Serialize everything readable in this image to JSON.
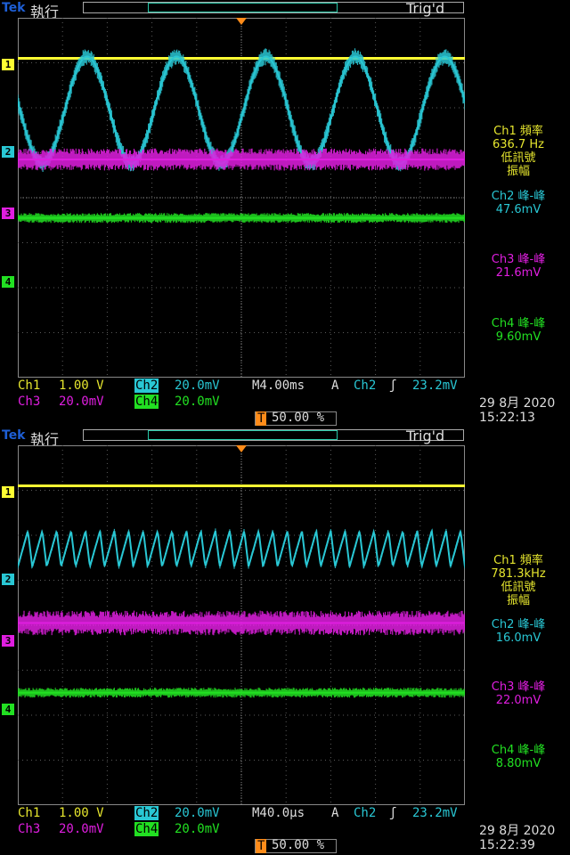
{
  "colors": {
    "ch1": "#ffff33",
    "ch2": "#29c7d4",
    "ch3": "#e01ee0",
    "ch4": "#22e022",
    "trigger": "#ff8c1a",
    "grid": "#5a5a5a",
    "background": "#000000"
  },
  "screens": [
    {
      "brand": "Tek",
      "run_state": "執行",
      "trig_state": "Trig'd",
      "measurements": [
        {
          "lines": [
            "Ch1 頻率",
            "636.7 Hz",
            "低訊號",
            "振幅"
          ]
        },
        {
          "lines": [
            "Ch2 峰-峰",
            "47.6mV"
          ]
        },
        {
          "lines": [
            "Ch3 峰-峰",
            "21.6mV"
          ]
        },
        {
          "lines": [
            "Ch4 峰-峰",
            "9.60mV"
          ]
        }
      ],
      "ch1_label": "Ch1",
      "ch1_scale": "1.00 V",
      "ch2_label": "Ch2",
      "ch2_scale": "20.0mV",
      "ch3_label": "Ch3",
      "ch3_scale": "20.0mV",
      "ch4_label": "Ch4",
      "ch4_scale": "20.0mV",
      "timebase": "M4.00ms",
      "trig_label": "A",
      "trig_ch": "Ch2",
      "trig_level": "23.2mV",
      "trig_pos": "50.00 %",
      "date": "29 8月  2020",
      "time": "15:22:13"
    },
    {
      "brand": "Tek",
      "run_state": "執行",
      "trig_state": "Trig'd",
      "measurements": [
        {
          "lines": [
            "Ch1 頻率",
            "781.3kHz",
            "低訊號",
            "振幅"
          ]
        },
        {
          "lines": [
            "Ch2 峰-峰",
            "16.0mV"
          ]
        },
        {
          "lines": [
            "Ch3 峰-峰",
            "22.0mV"
          ]
        },
        {
          "lines": [
            "Ch4 峰-峰",
            "8.80mV"
          ]
        }
      ],
      "ch1_label": "Ch1",
      "ch1_scale": "1.00 V",
      "ch2_label": "Ch2",
      "ch2_scale": "20.0mV",
      "ch3_label": "Ch3",
      "ch3_scale": "20.0mV",
      "ch4_label": "Ch4",
      "ch4_scale": "20.0mV",
      "timebase": "M40.0µs",
      "trig_label": "A",
      "trig_ch": "Ch2",
      "trig_level": "23.2mV",
      "trig_pos": "50.00 %",
      "date": "29 8月  2020",
      "time": "15:22:39"
    }
  ],
  "chart_data": [
    {
      "type": "line",
      "x_divisions": 10,
      "y_divisions": 8,
      "series": [
        {
          "name": "Ch1",
          "waveform": "flat",
          "level_div": 3.1
        },
        {
          "name": "Ch2",
          "waveform": "sine",
          "cycles": 5,
          "center_div": 1.95,
          "pp_div": 2.38,
          "noise_div": 0.35
        },
        {
          "name": "Ch3",
          "waveform": "noise",
          "center_div": 0.85,
          "noise_div": 0.45
        },
        {
          "name": "Ch4",
          "waveform": "noise",
          "center_div": -0.45,
          "noise_div": 0.2
        }
      ]
    },
    {
      "type": "line",
      "x_divisions": 10,
      "y_divisions": 8,
      "series": [
        {
          "name": "Ch1",
          "waveform": "flat",
          "level_div": 3.1
        },
        {
          "name": "Ch2",
          "waveform": "sawtooth",
          "cycles": 31,
          "center_div": 1.7,
          "pp_div": 0.8,
          "noise_div": 0.1
        },
        {
          "name": "Ch3",
          "waveform": "noise",
          "center_div": 0.05,
          "noise_div": 0.5
        },
        {
          "name": "Ch4",
          "waveform": "noise",
          "center_div": -1.5,
          "noise_div": 0.2
        }
      ]
    }
  ]
}
